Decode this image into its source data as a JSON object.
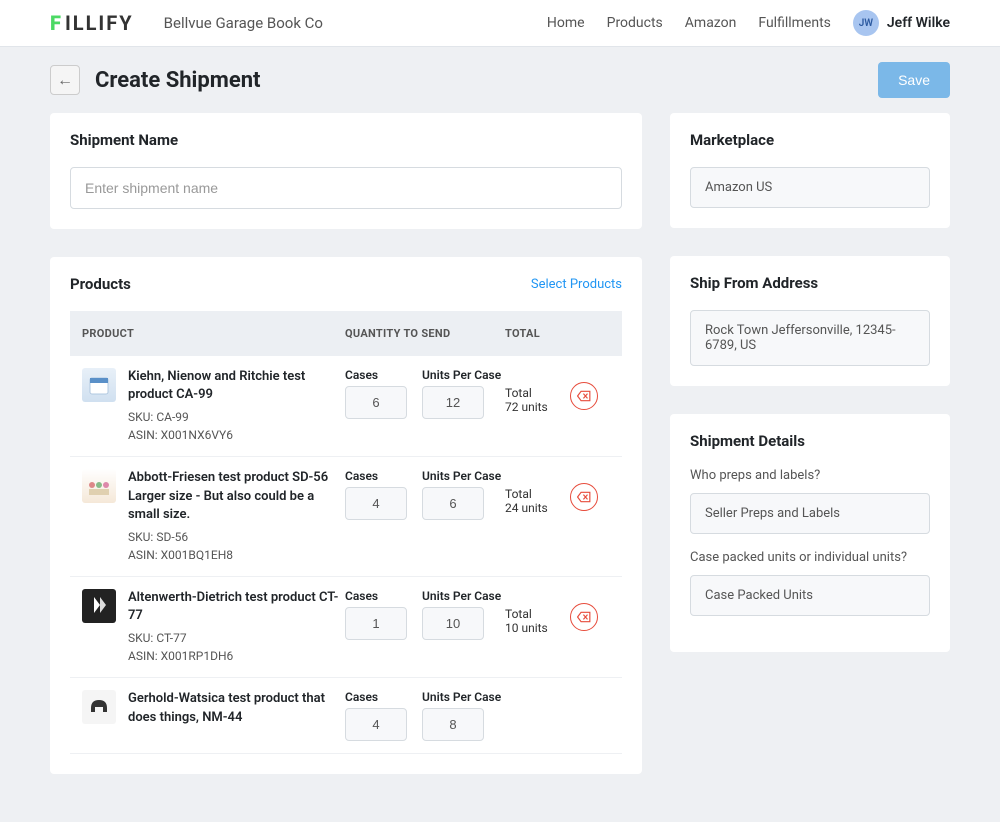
{
  "header": {
    "logo_text": "ILLIFY",
    "org_name": "Bellvue Garage Book Co",
    "nav": [
      "Home",
      "Products",
      "Amazon",
      "Fulfillments"
    ],
    "user_initials": "JW",
    "user_name": "Jeff Wilke"
  },
  "page": {
    "title": "Create Shipment",
    "save_label": "Save"
  },
  "shipment_name": {
    "heading": "Shipment Name",
    "placeholder": "Enter shipment name"
  },
  "products_section": {
    "heading": "Products",
    "select_link": "Select Products",
    "col_product": "PRODUCT",
    "col_qty": "QUANTITY TO SEND",
    "col_total": "TOTAL",
    "cases_label": "Cases",
    "units_label": "Units Per Case",
    "total_label": "Total"
  },
  "products": [
    {
      "name": "Kiehn, Nienow and Ritchie test product CA-99",
      "sku": "SKU: CA-99",
      "asin": "ASIN: X001NX6VY6",
      "cases": "6",
      "units_per_case": "12",
      "total": "72 units"
    },
    {
      "name": "Abbott-Friesen test product SD-56 Larger size - But also could be a small size.",
      "sku": "SKU: SD-56",
      "asin": "ASIN: X001BQ1EH8",
      "cases": "4",
      "units_per_case": "6",
      "total": "24 units"
    },
    {
      "name": "Altenwerth-Dietrich test product CT-77",
      "sku": "SKU: CT-77",
      "asin": "ASIN: X001RP1DH6",
      "cases": "1",
      "units_per_case": "10",
      "total": "10 units"
    },
    {
      "name": "Gerhold-Watsica test product that does things, NM-44",
      "sku": "",
      "asin": "",
      "cases": "4",
      "units_per_case": "8",
      "total": ""
    }
  ],
  "marketplace": {
    "heading": "Marketplace",
    "value": "Amazon US"
  },
  "ship_from": {
    "heading": "Ship From Address",
    "value": "Rock Town Jeffersonville, 12345-6789, US"
  },
  "details": {
    "heading": "Shipment Details",
    "preps_label": "Who preps and labels?",
    "preps_value": "Seller Preps and Labels",
    "packed_label": "Case packed units or individual units?",
    "packed_value": "Case Packed Units"
  }
}
